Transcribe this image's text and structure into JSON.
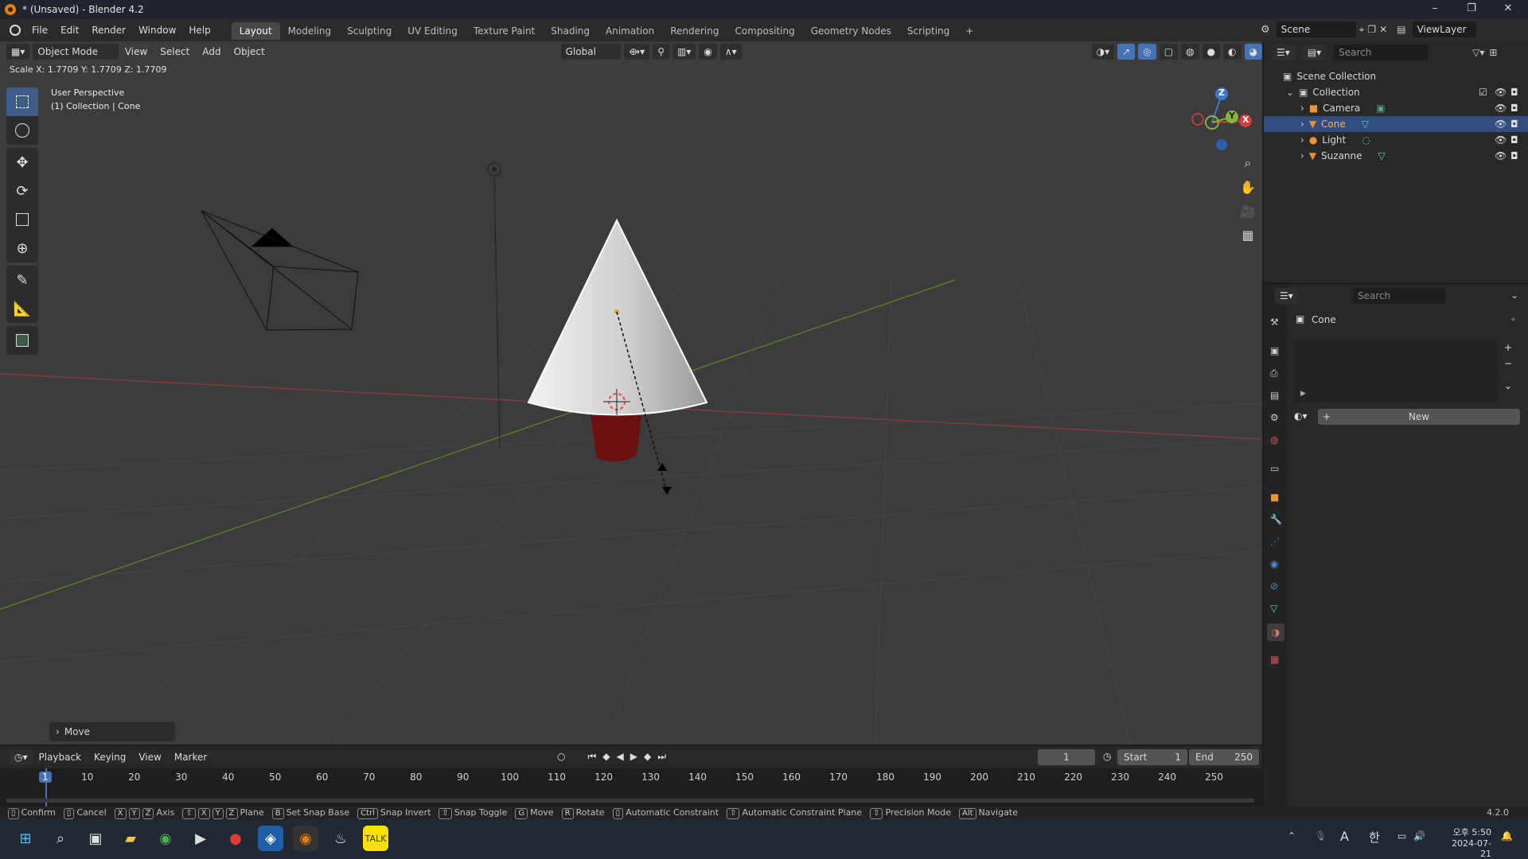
{
  "window": {
    "title": "* (Unsaved) - Blender 4.2"
  },
  "menus": [
    "File",
    "Edit",
    "Render",
    "Window",
    "Help"
  ],
  "workspaces": [
    "Layout",
    "Modeling",
    "Sculpting",
    "UV Editing",
    "Texture Paint",
    "Shading",
    "Animation",
    "Rendering",
    "Compositing",
    "Geometry Nodes",
    "Scripting",
    "+"
  ],
  "scene": {
    "name": "Scene",
    "view_layer": "ViewLayer"
  },
  "viewport": {
    "mode": "Object Mode",
    "menus": [
      "View",
      "Select",
      "Add",
      "Object"
    ],
    "transform_orientation": "Global",
    "scale_readout": "Scale X: 1.7709   Y: 1.7709   Z: 1.7709",
    "perspective": "User Perspective",
    "collection_info": "(1) Collection | Cone",
    "operator_panel": "Move",
    "gizmo": {
      "x": "X",
      "y": "Y",
      "z": "Z"
    }
  },
  "outliner": {
    "search_placeholder": "Search",
    "scene_collection": "Scene Collection",
    "collection": "Collection",
    "items": [
      "Camera",
      "Cone",
      "Light",
      "Suzanne"
    ],
    "selected": "Cone"
  },
  "properties": {
    "search_placeholder": "Search",
    "object_name": "Cone",
    "new_button": "New"
  },
  "timeline": {
    "menus": [
      "Playback",
      "Keying",
      "View",
      "Marker"
    ],
    "current_frame": "1",
    "start_label": "Start",
    "start": "1",
    "end_label": "End",
    "end": "250",
    "ticks": [
      "1",
      "10",
      "20",
      "30",
      "40",
      "50",
      "60",
      "70",
      "80",
      "90",
      "100",
      "110",
      "120",
      "130",
      "140",
      "150",
      "160",
      "170",
      "180",
      "190",
      "200",
      "210",
      "220",
      "230",
      "240",
      "250"
    ]
  },
  "statusbar": {
    "items": [
      {
        "key": "",
        "label": "Confirm"
      },
      {
        "key": "",
        "label": "Cancel"
      },
      {
        "key": "X Y Z",
        "label": "Axis"
      },
      {
        "key": "⇧ X Y Z",
        "label": "Plane"
      },
      {
        "key": "B",
        "label": "Set Snap Base"
      },
      {
        "key": "Ctrl",
        "label": "Snap Invert"
      },
      {
        "key": "⇧",
        "label": "Snap Toggle"
      },
      {
        "key": "G",
        "label": "Move"
      },
      {
        "key": "R",
        "label": "Rotate"
      },
      {
        "key": "",
        "label": "Automatic Constraint"
      },
      {
        "key": "⇧",
        "label": "Automatic Constraint Plane"
      },
      {
        "key": "⇧",
        "label": "Precision Mode"
      },
      {
        "key": "Alt",
        "label": "Navigate"
      }
    ],
    "version": "4.2.0"
  },
  "taskbar": {
    "time": "오후 5:50",
    "date": "2024-07-21",
    "ime": "A",
    "lang": "한"
  },
  "colors": {
    "accent": "#4772b3",
    "selected_row": "#334d80",
    "viewport_bg": "#3c3c3c",
    "x_axis": "#b53b3b",
    "y_axis": "#6a8f23"
  }
}
